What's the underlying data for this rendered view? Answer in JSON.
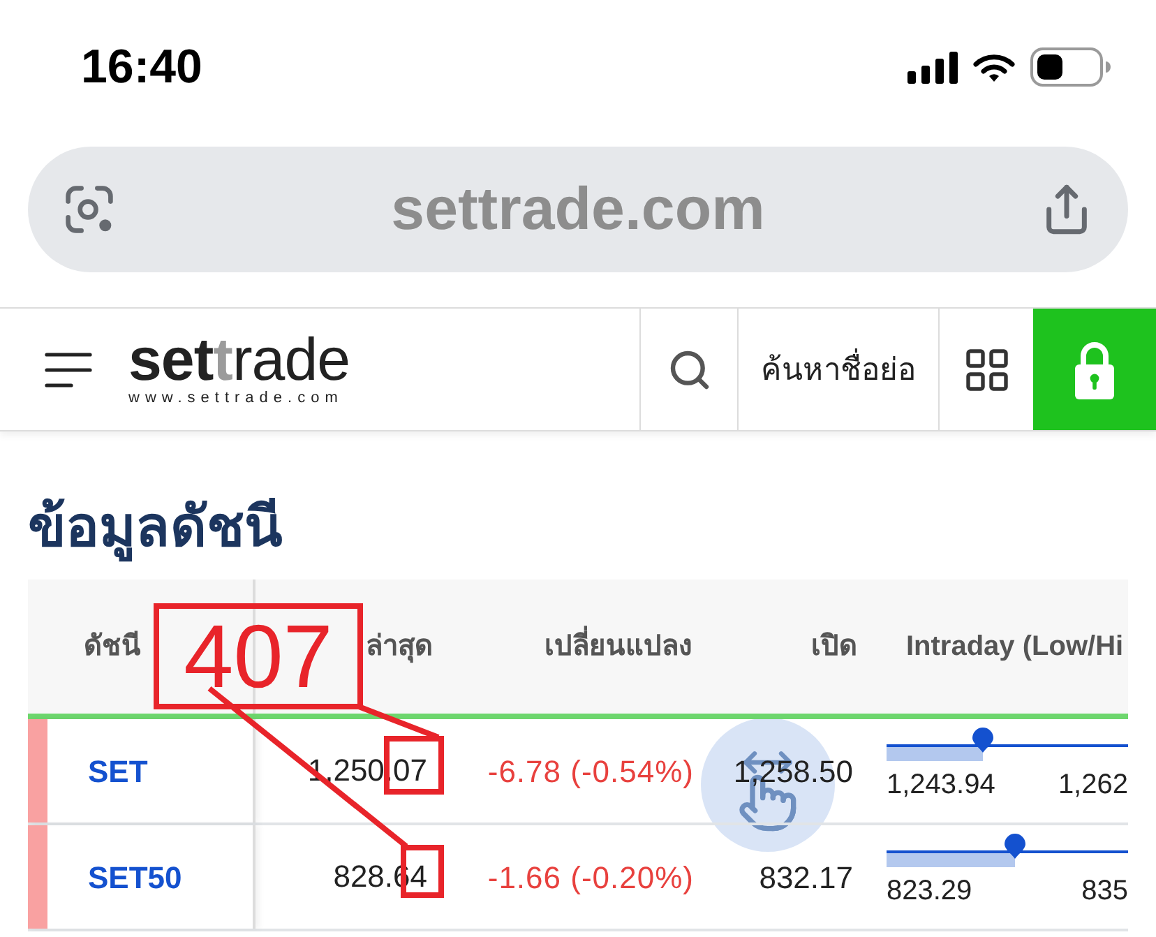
{
  "status_bar": {
    "time": "16:40"
  },
  "address_bar": {
    "url": "settrade.com"
  },
  "header": {
    "logo": {
      "wordmark": [
        {
          "text": "set",
          "kind": "bold"
        },
        {
          "text": "t",
          "kind": "accent"
        },
        {
          "text": "rade",
          "kind": "plain"
        }
      ],
      "tagline": "www.settrade.com"
    },
    "symbol_search": "ค้นหาชื่อย่อ"
  },
  "page_title": "ข้อมูลดัชนี",
  "table": {
    "columns": [
      "ดัชนี",
      "ล่าสุด",
      "เปลี่ยนแปลง",
      "เปิด",
      "Intraday (Low/Hi"
    ],
    "rows": [
      {
        "index": "SET",
        "down": true,
        "last": "1,250.07",
        "change": "-6.78 (-0.54%)",
        "open": "1,258.50",
        "intraday": {
          "low": "1,243.94",
          "high": "1,262",
          "level": 0.4
        }
      },
      {
        "index": "SET50",
        "down": true,
        "last": "828.64",
        "change": "-1.66 (-0.20%)",
        "open": "832.17",
        "intraday": {
          "low": "823.29",
          "high": "835",
          "level": 0.53
        }
      }
    ]
  },
  "annotation": {
    "label": "407"
  }
}
